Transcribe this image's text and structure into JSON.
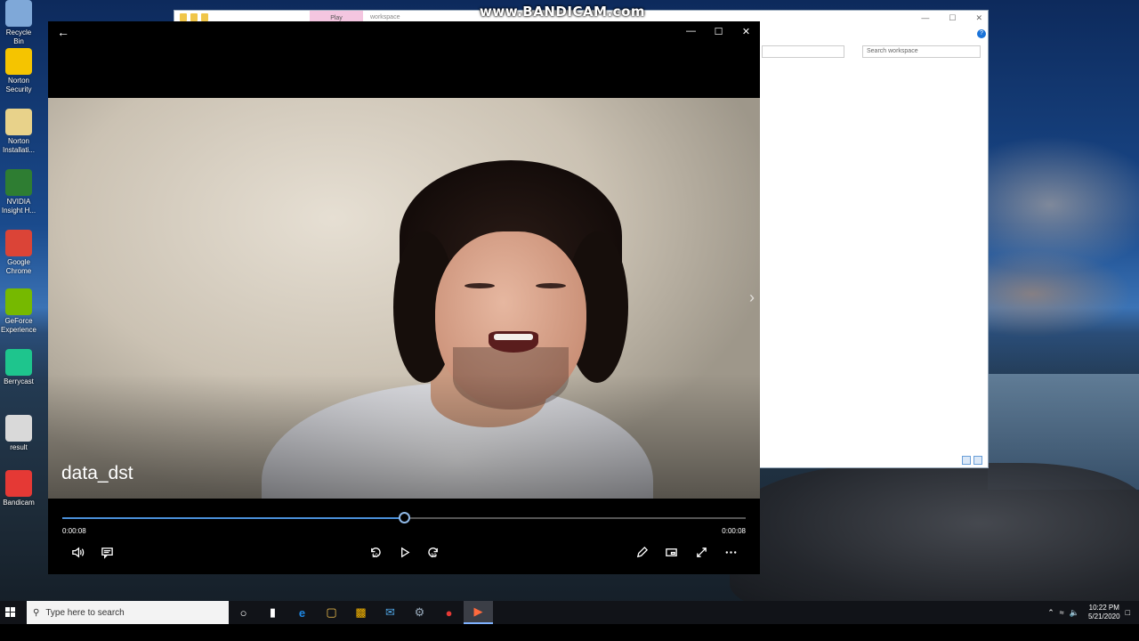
{
  "watermark": "www.BANDICAM.com",
  "desktop": {
    "icons": [
      {
        "label": "Recycle Bin",
        "icon": "recycle-bin-icon",
        "color": "#7fa8d8"
      },
      {
        "label": "Norton Security",
        "icon": "norton-icon",
        "color": "#f5c400"
      },
      {
        "label": "Norton Installati...",
        "icon": "norton-installer-icon",
        "color": "#e8d28a"
      },
      {
        "label": "NVIDIA Insight H...",
        "icon": "nvidia-insight-icon",
        "color": "#2e7d32"
      },
      {
        "label": "Google Chrome",
        "icon": "chrome-icon",
        "color": "#db4437"
      },
      {
        "label": "GeForce Experience",
        "icon": "geforce-icon",
        "color": "#76b900"
      },
      {
        "label": "Berrycast",
        "icon": "berrycast-icon",
        "color": "#1ec58d"
      },
      {
        "label": "result",
        "icon": "file-icon",
        "color": "#d9d9d9"
      },
      {
        "label": "Bandicam",
        "icon": "bandicam-icon",
        "color": "#e53935"
      }
    ]
  },
  "explorer": {
    "tab_play": "Play",
    "title": "workspace",
    "search_placeholder": "Search workspace",
    "help": "?"
  },
  "player": {
    "video_title": "data_dst",
    "current_time": "0:00:08",
    "duration": "0:00:08",
    "progress": 0.5,
    "skip_back": "10",
    "skip_forward": "30"
  },
  "taskbar": {
    "search_placeholder": "Type here to search",
    "time": "10:22 PM",
    "date": "5/21/2020"
  },
  "colors": {
    "accent": "#4a90d9",
    "taskbar": "#111318"
  }
}
